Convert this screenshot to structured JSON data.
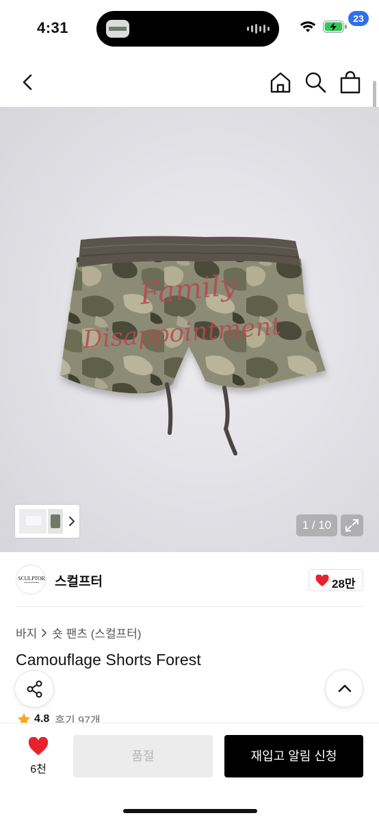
{
  "status_bar": {
    "time": "4:31"
  },
  "nav": {
    "back_icon": "chevron-left-icon",
    "home_icon": "home-icon",
    "search_icon": "search-icon",
    "bag_icon": "shopping-bag-icon",
    "bag_badge_count": "23",
    "badge_color": "#2f6fec"
  },
  "gallery": {
    "page_counter": "1 / 10",
    "current_image": 1,
    "total_images": 10,
    "expand_icon": "expand-icon",
    "thumbnail_chevron_icon": "chevron-right-icon",
    "image_description": "camouflage shorts with embroidered script",
    "embroidery_text_line1": "Family",
    "embroidery_text_line2": "Disappointment"
  },
  "brand": {
    "logo_text": "SCULPTOR",
    "name": "스컬프터",
    "like_count": "28만",
    "like_icon": "heart-icon",
    "like_color": "#e8222d"
  },
  "product": {
    "breadcrumb": [
      "바지",
      "숏 팬츠 (스컬프터)"
    ],
    "title": "Camouflage Shorts Forest",
    "rating": "4.8",
    "review_label": "후기 97개",
    "star_color": "#f5a623"
  },
  "actions": {
    "share_icon": "share-icon",
    "scroll_top_icon": "chevron-up-icon"
  },
  "bottom_bar": {
    "wish_count": "6천",
    "wish_icon": "heart-icon",
    "sold_out_label": "품절",
    "restock_label": "재입고 알림 신청"
  }
}
